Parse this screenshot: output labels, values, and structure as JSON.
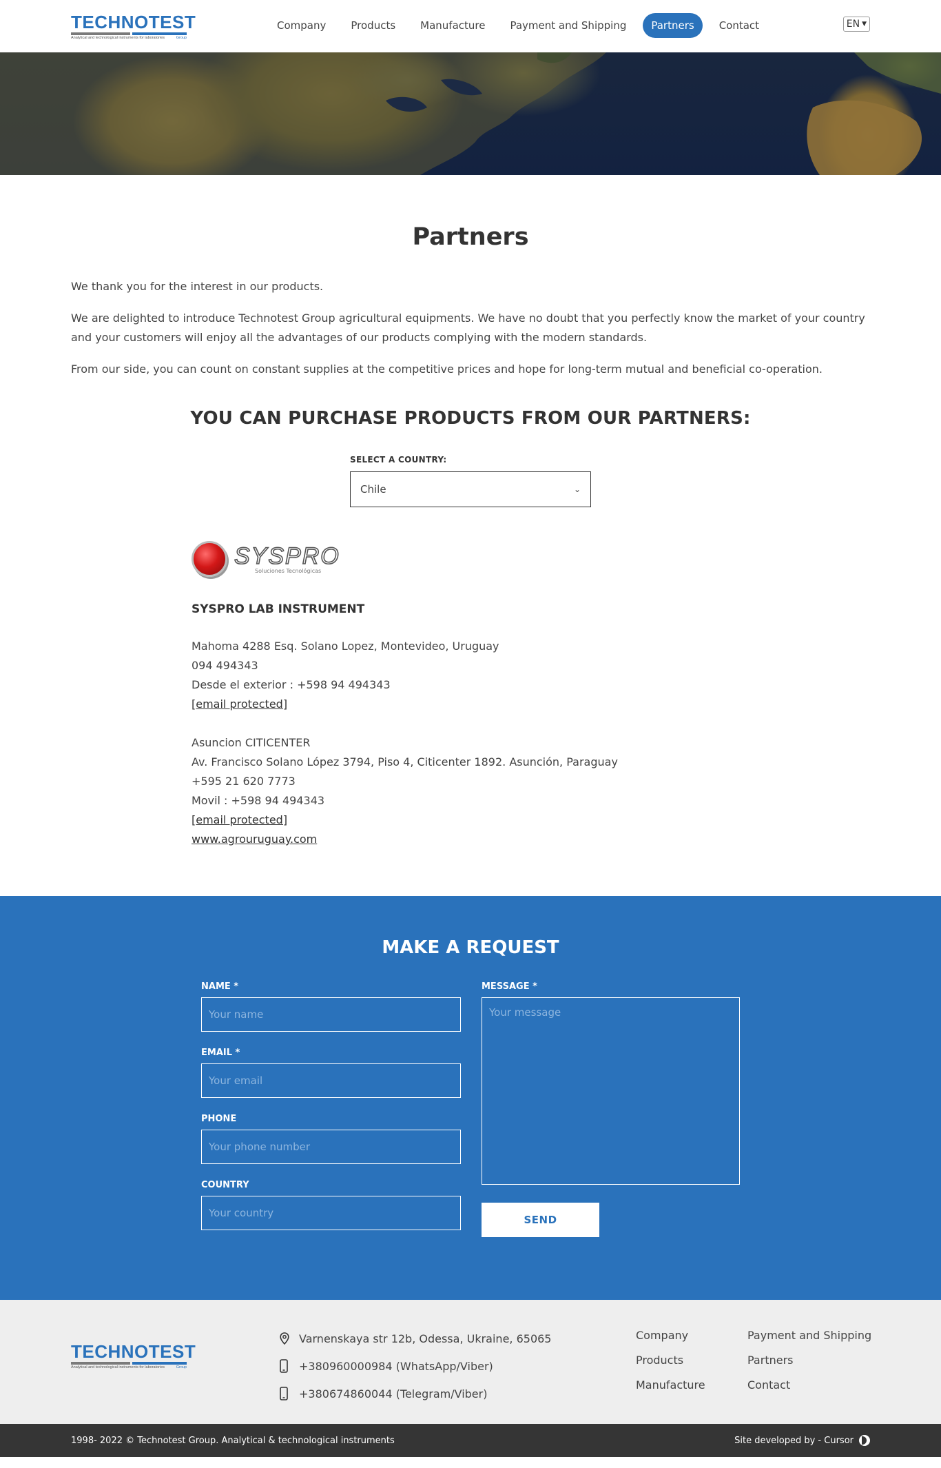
{
  "brand": {
    "logo_text": "TECHNOTEST",
    "logo_group": "Group",
    "logo_tagline": "Analytical and technological  instruments for laboratories"
  },
  "nav": {
    "items": [
      {
        "label": "Company"
      },
      {
        "label": "Products"
      },
      {
        "label": "Manufacture"
      },
      {
        "label": "Payment and Shipping"
      },
      {
        "label": "Partners",
        "active": true
      },
      {
        "label": "Contact"
      }
    ],
    "language": "EN"
  },
  "page": {
    "title": "Partners",
    "intro": [
      "We thank you for the interest in our products.",
      "We are delighted to introduce Technotest Group agricultural equipments. We have no doubt that you perfectly know the market of your country and your customers will enjoy all the advantages of our products complying with the modern standards.",
      "From our side, you can count on constant supplies at the competitive prices and hope for long-term mutual and beneficial co-operation."
    ],
    "partners_heading": "YOU CAN PURCHASE PRODUCTS FROM OUR PARTNERS:",
    "country_label": "SELECT A COUNTRY:",
    "country_selected": "Chile"
  },
  "partner": {
    "logo_name": "SYSPRO",
    "logo_sub": "Soluciones Tecnológicas",
    "name": "SYSPRO LAB INSTRUMENT",
    "office1": {
      "address": "Mahoma 4288 Esq. Solano Lopez, Montevideo, Uruguay",
      "phone": "094 494343",
      "abroad": "Desde el exterior : +598 94 494343",
      "email": "[email protected]"
    },
    "office2": {
      "name": "Asuncion CITICENTER",
      "address": "Av. Francisco Solano López 3794, Piso 4, Citicenter 1892. Asunción, Paraguay",
      "phone": "+595 21 620 7773",
      "mobile": "Movil : +598 94 494343",
      "email": "[email protected]",
      "website": "www.agrouruguay.com"
    }
  },
  "request": {
    "title": "MAKE A REQUEST",
    "name_label": "NAME *",
    "name_placeholder": "Your name",
    "email_label": "EMAIL *",
    "email_placeholder": "Your email",
    "phone_label": "PHONE",
    "phone_placeholder": "Your phone number",
    "country_label": "COUNTRY",
    "country_placeholder": "Your country",
    "message_label": "MESSAGE *",
    "message_placeholder": "Your message",
    "send_label": "SEND"
  },
  "footer": {
    "address": "Varnenskaya str 12b, Odessa, Ukraine, 65065",
    "phone1": "+380960000984 (WhatsApp/Viber)",
    "phone2": "+380674860044 (Telegram/Viber)",
    "links": [
      "Company",
      "Payment and Shipping",
      "Products",
      "Partners",
      "Manufacture",
      "Contact"
    ],
    "copyright": "1998- 2022 © Technotest Group. Analytical & technological instruments",
    "developer": "Site developed by - Cursor"
  },
  "colors": {
    "accent": "#2a72bb",
    "footer_bg": "#eeeeee",
    "bottom_bar": "#353535"
  }
}
